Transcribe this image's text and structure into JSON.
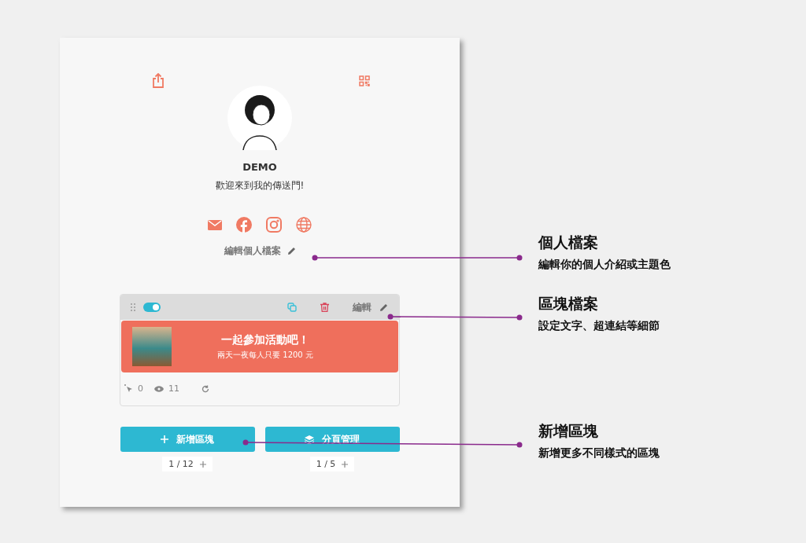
{
  "profile": {
    "name": "DEMO",
    "bio": "歡迎來到我的傳送門!",
    "edit_label": "編輯個人檔案"
  },
  "block": {
    "enabled": true,
    "edit_label": "編輯",
    "title": "一起參加活動吧！",
    "subtitle": "兩天一夜每人只要 1200 元",
    "clicks": "0",
    "views": "11"
  },
  "actions": [
    {
      "kind": "add",
      "label": "新增區塊",
      "count": "1 / 12"
    },
    {
      "kind": "pages",
      "label": "分頁管理",
      "count": "1 / 5"
    }
  ],
  "callouts": [
    {
      "title": "個人檔案",
      "description": "編輯你的個人介紹或主題色"
    },
    {
      "title": "區塊檔案",
      "description": "設定文字、超連結等細節"
    },
    {
      "title": "新增區塊",
      "description": "新增更多不同樣式的區塊"
    }
  ]
}
